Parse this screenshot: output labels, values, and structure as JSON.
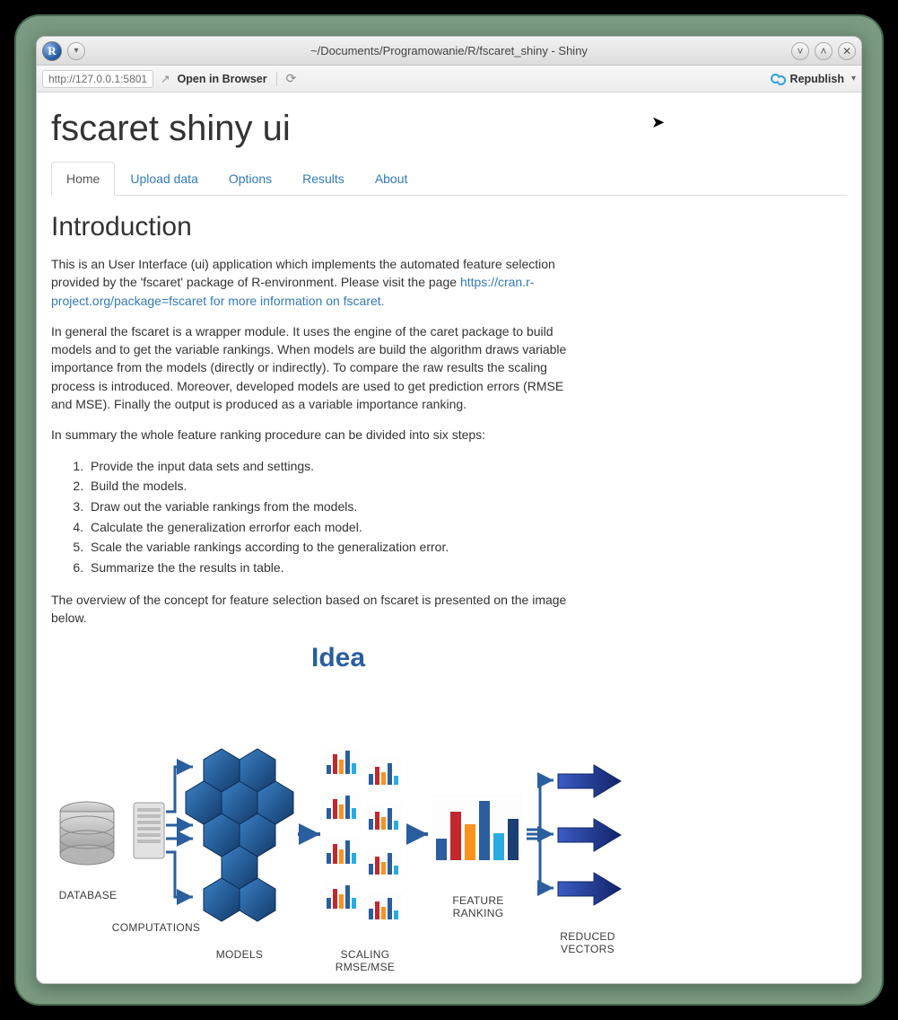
{
  "window": {
    "title": "~/Documents/Programowanie/R/fscaret_shiny - Shiny",
    "app_icon_letter": "R"
  },
  "toolbar": {
    "url": "http://127.0.0.1:5801",
    "open_in_browser_label": "Open in Browser",
    "republish_label": "Republish"
  },
  "app": {
    "title": "fscaret shiny ui",
    "tabs": [
      "Home",
      "Upload data",
      "Options",
      "Results",
      "About"
    ],
    "active_tab_index": 0
  },
  "intro": {
    "heading": "Introduction",
    "p1a": "This is an User Interface (ui) application which implements the automated feature selection provided by the 'fscaret' package of R-environment. Please visit the page ",
    "p1_link": "https://cran.r-project.org/package=fscaret for more information on fscaret.",
    "p2": "In general the fscaret is a wrapper module. It uses the engine of the caret package to build models and to get the variable rankings. When models are build the algorithm draws variable importance from the models (directly or indirectly). To compare the raw results the scaling process is introduced. Moreover, developed models are used to get prediction errors (RMSE and MSE). Finally the output is produced as a variable importance ranking.",
    "p3": "In summary the whole feature ranking procedure can be divided into six steps:",
    "steps": [
      "Provide the input data sets and settings.",
      "Build the models.",
      "Draw out the variable rankings from the models.",
      "Calculate the generalization errorfor each model.",
      "Scale the variable rankings according to the generalization error.",
      "Summarize the the results in table."
    ],
    "p4": "The overview of the concept for feature selection based on fscaret is presented on the image below."
  },
  "diagram": {
    "title": "Idea",
    "labels": {
      "database": "DATABASE",
      "computations": "COMPUTATIONS",
      "models": "MODELS",
      "scaling": "SCALING RMSE/MSE",
      "feature_ranking": "FEATURE RANKING",
      "reduced_vectors": "REDUCED VECTORS"
    }
  }
}
